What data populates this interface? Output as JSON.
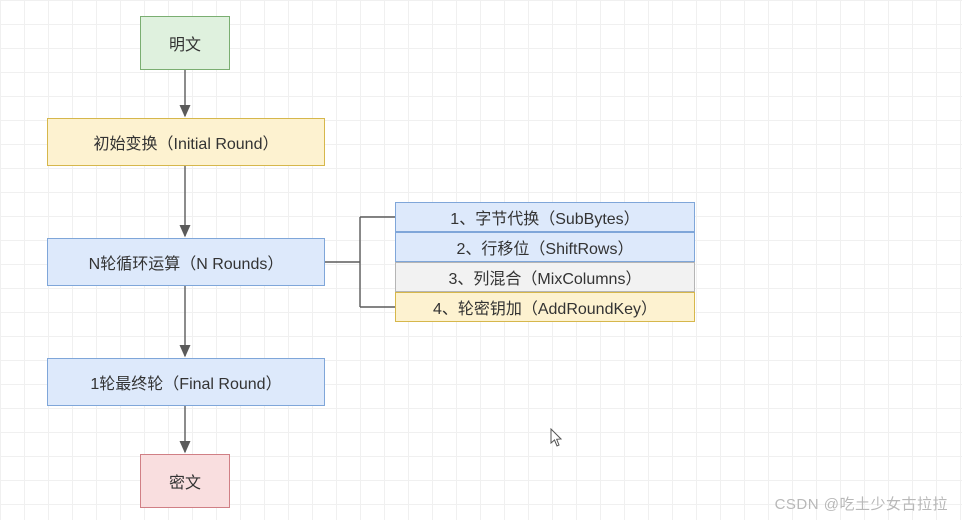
{
  "diagram": {
    "plaintext": "明文",
    "initial_round": "初始变换（Initial Round）",
    "n_rounds": "N轮循环运算（N Rounds）",
    "final_round": "1轮最终轮（Final Round）",
    "ciphertext": "密文",
    "steps": {
      "s1": "1、字节代换（SubBytes）",
      "s2": "2、行移位（ShiftRows）",
      "s3": "3、列混合（MixColumns）",
      "s4": "4、轮密钥加（AddRoundKey）"
    }
  },
  "watermark": "CSDN @吃土少女古拉拉",
  "colors": {
    "green": "#dff1de",
    "yellow": "#fdf2d0",
    "blue": "#dde9fb",
    "gray": "#f2f2f2",
    "pink": "#f9dedf"
  }
}
